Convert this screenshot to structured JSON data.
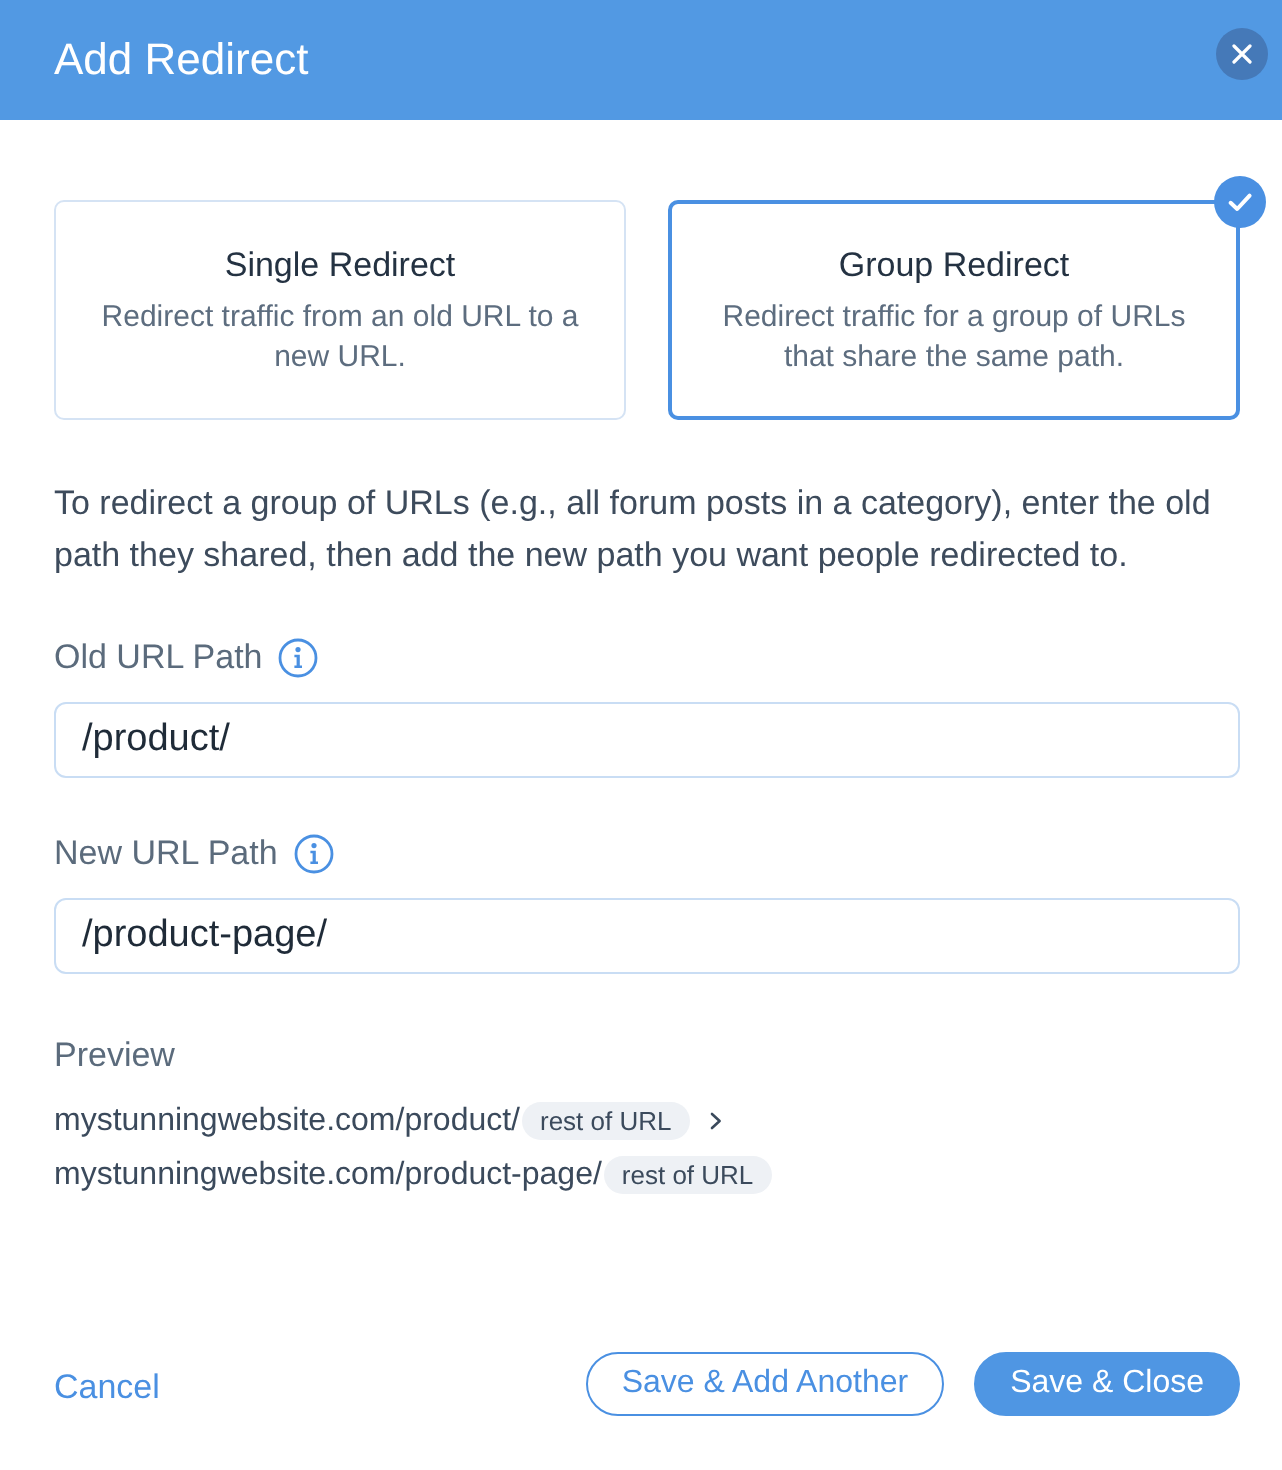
{
  "dialog": {
    "title": "Add Redirect"
  },
  "redirect_types": [
    {
      "title": "Single Redirect",
      "description": "Redirect traffic from an old URL to a new URL.",
      "selected": false
    },
    {
      "title": "Group Redirect",
      "description": "Redirect traffic for a group of URLs that share the same path.",
      "selected": true
    }
  ],
  "intro": "To redirect a group of URLs (e.g., all forum posts in a category), enter the old path they shared, then add the new path you want people redirected to.",
  "fields": [
    {
      "label": "Old URL Path",
      "value": "/product/"
    },
    {
      "label": "New URL Path",
      "value": "/product-page/"
    }
  ],
  "preview": {
    "label": "Preview",
    "rows": [
      {
        "kind": "source",
        "url": "mystunningwebsite.com/product/",
        "tag": "rest of URL"
      },
      {
        "kind": "target",
        "url": "mystunningwebsite.com/product-page/",
        "tag": "rest of URL"
      }
    ]
  },
  "footer": {
    "cancel": "Cancel",
    "buttons": [
      {
        "kind": "secondary",
        "label": "Save & Add Another"
      },
      {
        "kind": "primary",
        "label": "Save & Close"
      }
    ]
  }
}
